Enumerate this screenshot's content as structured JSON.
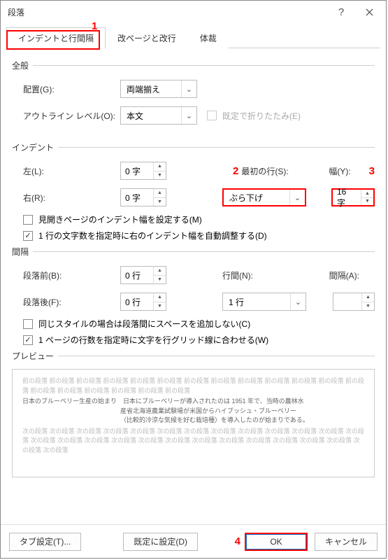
{
  "title": "段落",
  "tabs": {
    "indent": "インデントと行間隔",
    "page": "改ページと改行",
    "style": "体裁"
  },
  "general": {
    "title": "全般",
    "alignment_label": "配置(G):",
    "alignment_value": "両端揃え",
    "outline_label": "アウトライン レベル(O):",
    "outline_value": "本文",
    "collapse_label": "既定で折りたたみ(E)"
  },
  "indent": {
    "title": "インデント",
    "left_label": "左(L):",
    "left_value": "0 字",
    "right_label": "右(R):",
    "right_value": "0 字",
    "firstline_label": "最初の行(S):",
    "firstline_value": "ぶら下げ",
    "width_label": "幅(Y):",
    "width_value": "16 字",
    "mirror_label": "見開きページのインデント幅を設定する(M)",
    "auto_label": "1 行の文字数を指定時に右のインデント幅を自動調整する(D)"
  },
  "spacing": {
    "title": "間隔",
    "before_label": "段落前(B):",
    "before_value": "0 行",
    "after_label": "段落後(F):",
    "after_value": "0 行",
    "line_label": "行間(N):",
    "line_value": "1 行",
    "gap_label": "間隔(A):",
    "gap_value": "",
    "nospace_label": "同じスタイルの場合は段落間にスペースを追加しない(C)",
    "grid_label": "1 ページの行数を指定時に文字を行グリッド線に合わせる(W)"
  },
  "preview": {
    "title": "プレビュー",
    "prev_repeat": "前の段落 前の段落 前の段落 前の段落 前の段落 前の段落 前の段落 前の段落 前の段落 前の段落 前の段落 前の段落 前の段落 前の段落 前の段落 前の段落 前の段落 前の段落 前の段落",
    "body_line1": "日本のブルーベリー生産の始まり　日本にブルーベリーが導入されたのは 1951 年で、当時の農林水",
    "body_line2": "産省北海道農業試験場が米国からハイブッシュ・ブルーベリー",
    "body_line3": "（比較的冷涼な気候を好む栽培種）を導入したのが始まりである。",
    "next_repeat": "次の段落 次の段落 次の段落 次の段落 次の段落 次の段落 次の段落 次の段落 次の段落 次の段落 次の段落 次の段落 次の段落 次の段落 次の段落 次の段落 次の段落 次の段落 次の段落 次の段落 次の段落 次の段落 次の段落 次の段落 次の段落 次の段落 次の段落"
  },
  "footer": {
    "tabstop": "タブ設定(T)...",
    "setdefault": "既定に設定(D)",
    "ok": "OK",
    "cancel": "キャンセル"
  },
  "annotations": {
    "n1": "1",
    "n2": "2",
    "n3": "3",
    "n4": "4"
  }
}
